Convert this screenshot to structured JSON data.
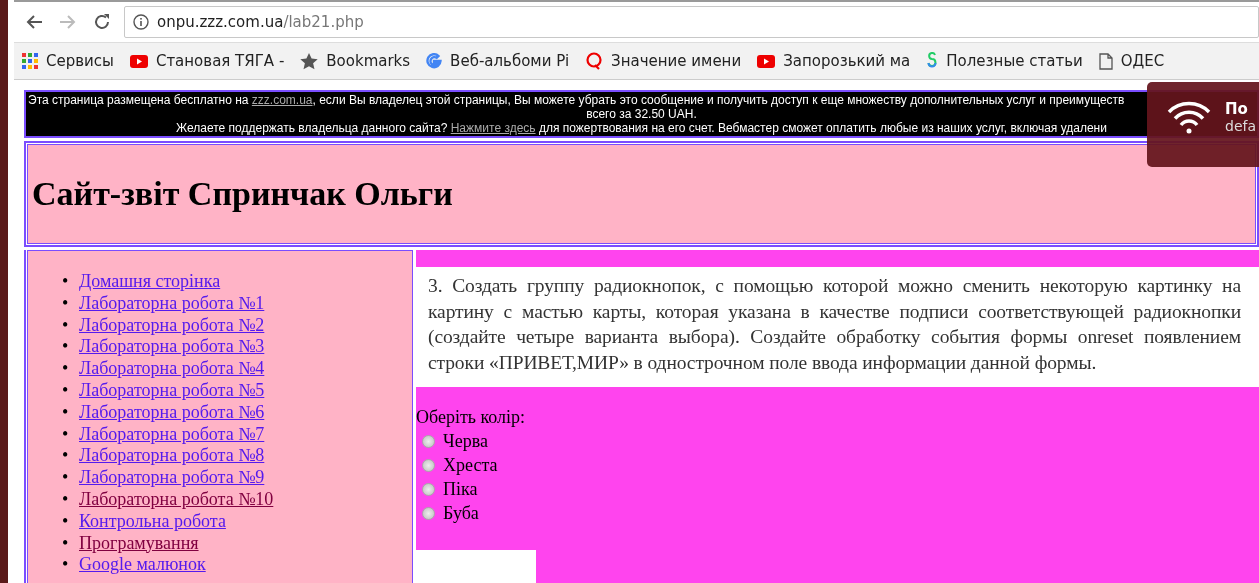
{
  "browser": {
    "url_host": "onpu.zzz.com.ua",
    "url_path": "/lab21.php",
    "bookmarks": [
      {
        "kind": "apps",
        "label": "Сервисы"
      },
      {
        "kind": "video",
        "label": "Становая ТЯГА -"
      },
      {
        "kind": "star",
        "label": "Bookmarks"
      },
      {
        "kind": "g",
        "label": "Веб-альбоми Pi"
      },
      {
        "kind": "q",
        "label": "Значение имени"
      },
      {
        "kind": "video",
        "label": "Запорозький ма"
      },
      {
        "kind": "s",
        "label": "Полезные статьи"
      },
      {
        "kind": "doc",
        "label": "ОДЕС"
      }
    ]
  },
  "banner": {
    "line1_before": "Эта страница размещена бесплатно на",
    "line1_link": "zzz.com.ua",
    "line1_after": ", если Вы владелец этой страницы, Вы можете убрать это сообщение и получить доступ к еще множеству дополнительных услуг и преимуществ",
    "line2": "всего за 32.50 UAH.",
    "line3_before": "Желаете поддержать владельца данного сайта?",
    "line3_link": "Нажмите здесь",
    "line3_after": "для пожертвования на его счет. Вебмастер сможет оплатить любые из наших услуг, включая удалени"
  },
  "notification": {
    "title": "По",
    "text": "defa"
  },
  "header": {
    "title": "Сайт-звіт Спринчак Ольги"
  },
  "sidebar": {
    "bullet": "•",
    "items": [
      {
        "label": "Домашня сторінка",
        "visited": false
      },
      {
        "label": "Лабораторна робота №1",
        "visited": false
      },
      {
        "label": "Лабораторна робота №2",
        "visited": false
      },
      {
        "label": "Лабораторна робота №3",
        "visited": false
      },
      {
        "label": "Лабораторна робота №4",
        "visited": false
      },
      {
        "label": "Лабораторна робота №5",
        "visited": false
      },
      {
        "label": "Лабораторна робота №6",
        "visited": false
      },
      {
        "label": "Лабораторна робота №7",
        "visited": false
      },
      {
        "label": "Лабораторна робота №8",
        "visited": false
      },
      {
        "label": "Лабораторна робота №9",
        "visited": false
      },
      {
        "label": "Лабораторна робота №10",
        "visited": true
      },
      {
        "label": "Контрольна робота",
        "visited": false
      },
      {
        "label": "Програмування",
        "visited": true
      },
      {
        "label": "Google малюнок",
        "visited": false
      }
    ]
  },
  "content": {
    "task": "3. Создать группу радиокнопок, с помощью которой можно сменить некоторую картинку на картину с мастью карты, которая указана в качестве подписи соответствующей радиокнопки (создайте четыре варианта выбора). Создайте обработку события формы onreset появлением строки «ПРИВЕТ,МИР» в однострочном поле ввода информации данной формы.",
    "form_label": "Оберіть колір:",
    "options": [
      {
        "label": "Черва",
        "selected": false
      },
      {
        "label": "Хреста",
        "selected": false
      },
      {
        "label": "Піка",
        "selected": false
      },
      {
        "label": "Буба",
        "selected": false
      }
    ]
  }
}
